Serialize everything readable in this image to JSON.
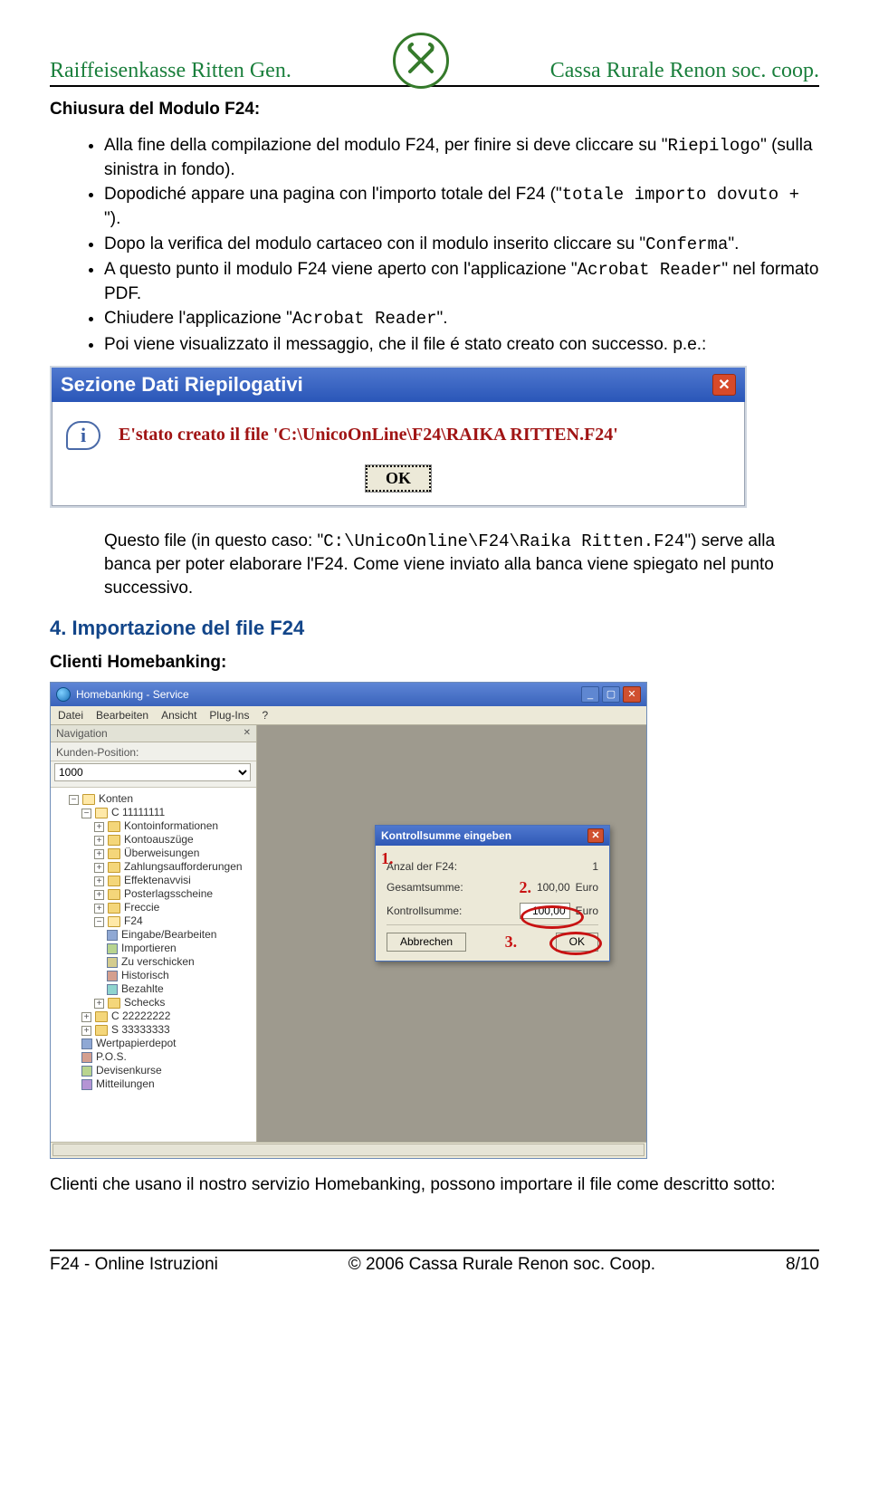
{
  "header": {
    "left": "Raiffeisenkasse Ritten Gen.",
    "right": "Cassa Rurale Renon soc. coop."
  },
  "section_a_title": "Chiusura del Modulo F24:",
  "bullets": [
    {
      "pre": "Alla fine della compilazione del modulo F24, per finire si deve cliccare su \"",
      "mono": "Riepilogo",
      "post": "\" (sulla sinistra in fondo)."
    },
    {
      "pre": "Dopodiché appare una pagina con l'importo totale del F24 (\"",
      "mono": "totale importo dovuto + ",
      "post": "\")."
    },
    {
      "pre": "Dopo la verifica del modulo cartaceo con il modulo inserito cliccare su \"",
      "mono": "Conferma",
      "post": "\"."
    },
    {
      "pre": "A questo punto il modulo F24 viene aperto con l'applicazione \"",
      "mono": "Acrobat Reader",
      "post": "\" nel formato PDF."
    },
    {
      "pre": "Chiudere l'applicazione \"",
      "mono": "Acrobat Reader",
      "post": "\"."
    },
    {
      "pre": "Poi viene visualizzato il messaggio, che il file é stato creato con successo. p.e.:",
      "mono": "",
      "post": ""
    }
  ],
  "dialog": {
    "title": "Sezione Dati Riepilogativi",
    "message": "E'stato creato il file 'C:\\UnicoOnLine\\F24\\RAIKA RITTEN.F24'",
    "ok": "OK"
  },
  "after_dialog": {
    "pre": "Questo file (in questo caso: \"",
    "mono": "C:\\UnicoOnline\\F24\\Raika Ritten.F24",
    "post": "\") serve alla banca per poter elaborare l'F24. Come viene inviato alla banca viene spiegato nel punto successivo."
  },
  "h2": "4. Importazione del file F24",
  "sub": "Clienti Homebanking:",
  "hb": {
    "title": "Homebanking - Service",
    "menu": [
      "Datei",
      "Bearbeiten",
      "Ansicht",
      "Plug-Ins",
      "?"
    ],
    "nav_title": "Navigation",
    "nav_pin": "✕",
    "kunden_label": "Kunden-Position:",
    "kunden_value": "1000",
    "tree": {
      "root": "Konten",
      "acct1": "C 11111111",
      "under_acct1": [
        "Kontoinformationen",
        "Kontoauszüge",
        "Überweisungen",
        "Zahlungsaufforderungen",
        "Effektenavvisi",
        "Posterlagsscheine",
        "Freccie"
      ],
      "f24_label": "F24",
      "f24_children": [
        "Eingabe/Bearbeiten",
        "Importieren",
        "Zu verschicken",
        "Historisch",
        "Bezahlte"
      ],
      "after_f24": "Schecks",
      "acct2": "C 22222222",
      "acct3": "S 33333333",
      "bottom": [
        "Wertpapierdepot",
        "P.O.S.",
        "Devisenkurse",
        "Mitteilungen"
      ]
    },
    "popup": {
      "title": "Kontrollsumme eingeben",
      "row1_label": "Anzal der F24:",
      "row1_value": "1",
      "row2_label": "Gesamtsumme:",
      "row2_value": "100,00",
      "row3_label": "Kontrollsumme:",
      "row3_value": "100,00",
      "euro": "Euro",
      "cancel": "Abbrechen",
      "ok": "OK",
      "ann1": "1.",
      "ann2": "2.",
      "ann3": "3."
    }
  },
  "para_bottom": "Clienti che usano il nostro servizio Homebanking, possono importare il file come descritto sotto:",
  "footer": {
    "left": "F24 - Online Istruzioni",
    "center": "© 2006 Cassa Rurale Renon soc. Coop.",
    "right": "8/10"
  }
}
